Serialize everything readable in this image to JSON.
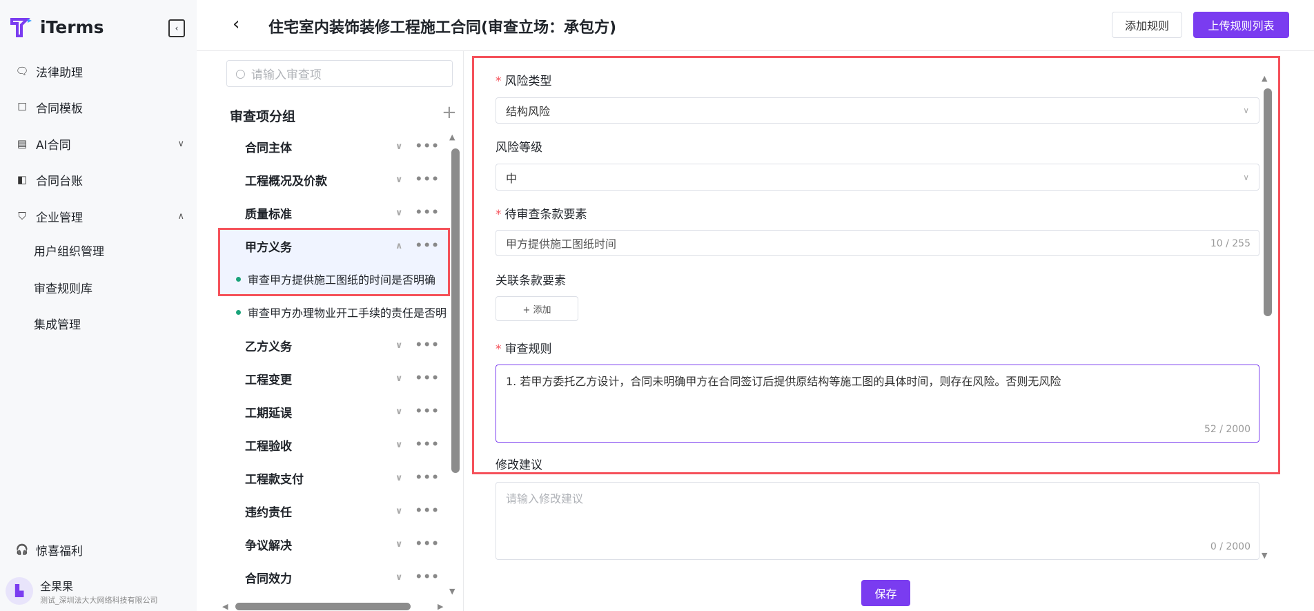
{
  "sidebar": {
    "brand": "iTerms",
    "items": [
      {
        "label": "法律助理",
        "icon": "chat-icon"
      },
      {
        "label": "合同模板",
        "icon": "archive-icon"
      },
      {
        "label": "AI合同",
        "icon": "document-icon"
      },
      {
        "label": "合同台账",
        "icon": "ledger-icon"
      },
      {
        "label": "企业管理",
        "icon": "shield-icon"
      }
    ],
    "sub_items": [
      "用户组织管理",
      "审查规则库",
      "集成管理"
    ],
    "bonus": "惊喜福利",
    "user": {
      "name": "全果果",
      "org": "测试_深圳法大大网络科技有限公司"
    }
  },
  "header": {
    "title": "住宅室内装饰装修工程施工合同(审查立场：承包方)",
    "add_rule": "添加规则",
    "upload_list": "上传规则列表"
  },
  "list": {
    "search_placeholder": "请输入审查项",
    "group_title": "审查项分组",
    "groups": [
      "合同主体",
      "工程概况及价款",
      "质量标准",
      "甲方义务"
    ],
    "expanded_children": [
      "审查甲方提供施工图纸的时间是否明确",
      "审查甲方办理物业开工手续的责任是否明确"
    ],
    "groups_after": [
      "乙方义务",
      "工程变更",
      "工期延误",
      "工程验收",
      "工程款支付",
      "违约责任",
      "争议解决",
      "合同效力"
    ]
  },
  "form": {
    "risk_type_label": "风险类型",
    "risk_type_value": "结构风险",
    "risk_level_label": "风险等级",
    "risk_level_value": "中",
    "clause_label": "待审查条款要素",
    "clause_value": "甲方提供施工图纸时间",
    "clause_count": "10 / 255",
    "related_label": "关联条款要素",
    "add_label": "+ 添加",
    "rule_label": "审查规则",
    "rule_value": "1. 若甲方委托乙方设计，合同未明确甲方在合同签订后提供原结构等施工图的具体时间，则存在风险。否则无风险",
    "rule_count": "52 / 2000",
    "suggest_label": "修改建议",
    "suggest_placeholder": "请输入修改建议",
    "suggest_count": "0 / 2000",
    "save": "保存",
    "required_mark": "*"
  },
  "colors": {
    "accent": "#7a3cf0",
    "highlight": "#f5515a",
    "dot": "#1aa37a"
  }
}
